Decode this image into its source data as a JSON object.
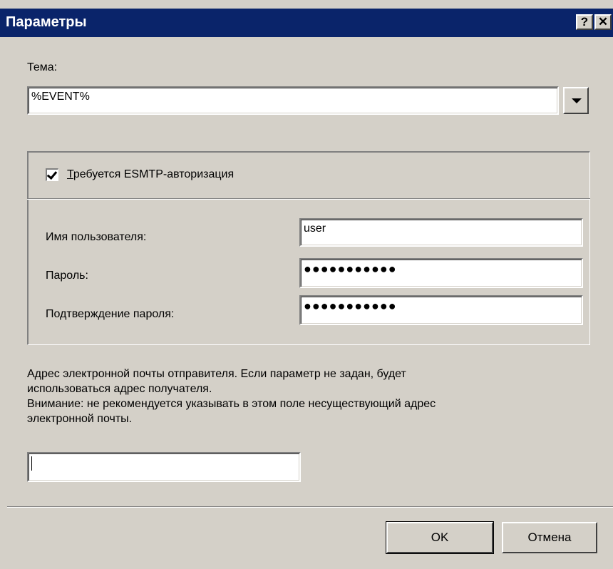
{
  "window": {
    "title": "Параметры",
    "help_label": "?",
    "close_label": "✕"
  },
  "subject": {
    "label": "Тема:",
    "value": "%EVENT%"
  },
  "auth": {
    "checkbox_label_u": "Т",
    "checkbox_label_rest": "ребуется ESMTP-авторизация",
    "checked": true,
    "username_label": "Имя пользователя:",
    "username_value": "user",
    "password_label": "Пароль:",
    "password_value": "●●●●●●●●●●●",
    "confirm_label": "Подтверждение пароля:",
    "confirm_value": "●●●●●●●●●●●"
  },
  "sender": {
    "desc_line1": "Адрес электронной почты отправителя. Если параметр не задан, будет",
    "desc_line2": "использоваться адрес получателя.",
    "desc_line3": "Внимание: не рекомендуется указывать в этом поле несуществующий адрес",
    "desc_line4": "электронной почты.",
    "value": ""
  },
  "buttons": {
    "ok": "OK",
    "cancel": "Отмена"
  }
}
